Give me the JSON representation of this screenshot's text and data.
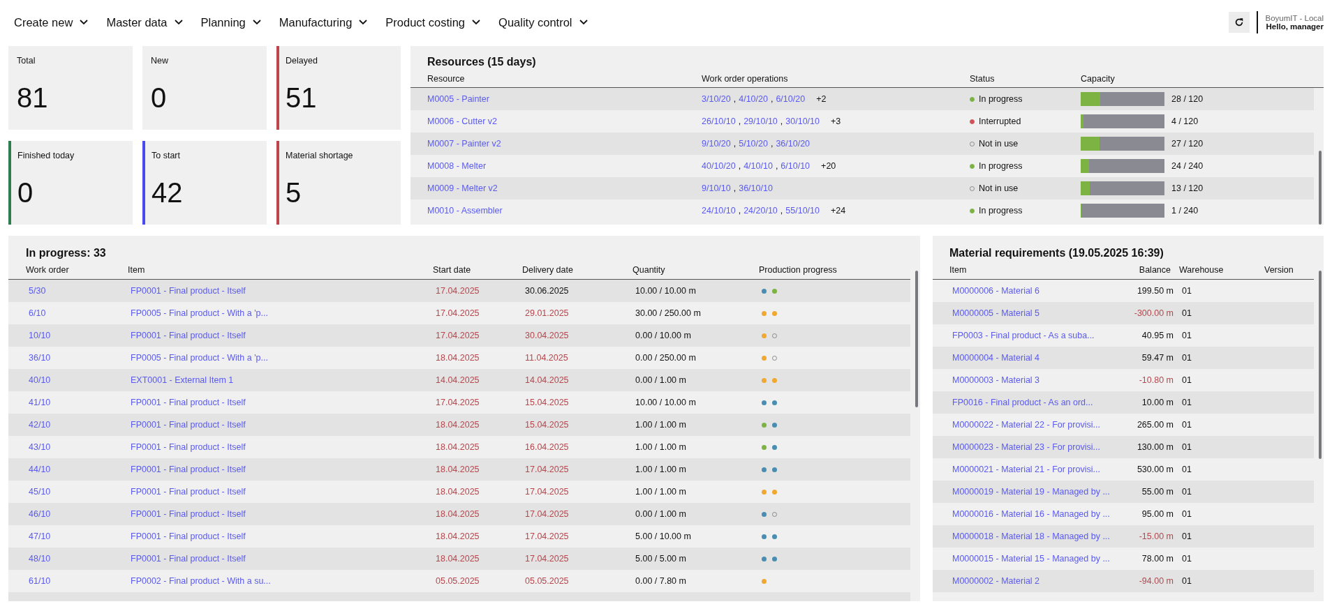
{
  "nav": {
    "menus": [
      {
        "label": "Create new"
      },
      {
        "label": "Master data"
      },
      {
        "label": "Planning"
      },
      {
        "label": "Manufacturing"
      },
      {
        "label": "Product costing"
      },
      {
        "label": "Quality control"
      }
    ],
    "company": "BoyumIT - Local",
    "greeting": "Hello, manager"
  },
  "kpis": [
    {
      "label": "Total",
      "value": "81"
    },
    {
      "label": "New",
      "value": "0"
    },
    {
      "label": "Delayed",
      "value": "51",
      "color": "#c0444c"
    },
    {
      "label": "Finished today",
      "value": "0",
      "color": "#2e7d4f"
    },
    {
      "label": "To start",
      "value": "42",
      "color": "#4a4af0"
    },
    {
      "label": "Material shortage",
      "value": "5",
      "color": "#c0444c"
    }
  ],
  "resources": {
    "title": "Resources (15 days)",
    "separator": ",",
    "columns": [
      "Resource",
      "Work order operations",
      "Status",
      "Capacity"
    ],
    "rows": [
      {
        "resource": "M0005 - Painter",
        "operations": [
          "3/10/20",
          "4/10/20",
          "6/10/20"
        ],
        "more": "+2",
        "status": {
          "kind": "in_progress",
          "label": "In progress"
        },
        "level": 0.233,
        "capacity": "28 / 120"
      },
      {
        "resource": "M0006 - Cutter v2",
        "operations": [
          "26/10/10",
          "29/10/10",
          "30/10/10"
        ],
        "more": "+3",
        "status": {
          "kind": "interrupted",
          "label": "Interrupted"
        },
        "level": 0.033,
        "capacity": "4 / 120"
      },
      {
        "resource": "M0007 - Painter v2",
        "operations": [
          "9/10/20",
          "5/10/20",
          "36/10/20"
        ],
        "status": {
          "kind": "not_in_use",
          "label": "Not in use"
        },
        "level": 0.225,
        "capacity": "27 / 120"
      },
      {
        "resource": "M0008 - Melter",
        "operations": [
          "40/10/20",
          "4/10/10",
          "6/10/10"
        ],
        "more": "+20",
        "status": {
          "kind": "in_progress",
          "label": "In progress"
        },
        "level": 0.1,
        "capacity": "24 / 240"
      },
      {
        "resource": "M0009 - Melter v2",
        "operations": [
          "9/10/10",
          "36/10/10"
        ],
        "status": {
          "kind": "not_in_use",
          "label": "Not in use"
        },
        "level": 0.108,
        "capacity": "13 / 120"
      },
      {
        "resource": "M0010 - Assembler",
        "operations": [
          "24/10/10",
          "24/20/10",
          "55/10/10"
        ],
        "more": "+24",
        "status": {
          "kind": "in_progress",
          "label": "In progress"
        },
        "level": 0.004,
        "capacity": "1 / 240"
      }
    ]
  },
  "in_progress": {
    "title": "In progress: 33",
    "columns": [
      "Work order",
      "Item",
      "Start date",
      "Delivery date",
      "Quantity",
      "Production progress"
    ],
    "rows": [
      {
        "work_order": "5/30",
        "item": "FP0001 - Final product - Itself",
        "start_date": "17.04.2025",
        "start_late": true,
        "delivery_date": "30.06.2025",
        "delivery_late": false,
        "quantity": "10.00 / 10.00 m",
        "progress": [
          {
            "kind": "filled",
            "color": "#4a8db0"
          },
          {
            "kind": "filled",
            "color": "#7cb342"
          }
        ]
      },
      {
        "work_order": "6/10",
        "item": "FP0005 - Final product - With a 'p...",
        "start_date": "17.04.2025",
        "start_late": true,
        "delivery_date": "29.01.2025",
        "delivery_late": true,
        "quantity": "30.00 / 250.00 m",
        "progress": [
          {
            "kind": "filled",
            "color": "#f0a830"
          },
          {
            "kind": "filled",
            "color": "#f0a830"
          }
        ]
      },
      {
        "work_order": "10/10",
        "item": "FP0001 - Final product - Itself",
        "start_date": "17.04.2025",
        "start_late": true,
        "delivery_date": "30.04.2025",
        "delivery_late": true,
        "quantity": "0.00 / 10.00 m",
        "progress": [
          {
            "kind": "filled",
            "color": "#f0a830"
          },
          {
            "kind": "empty"
          }
        ]
      },
      {
        "work_order": "36/10",
        "item": "FP0005 - Final product - With a 'p...",
        "start_date": "18.04.2025",
        "start_late": true,
        "delivery_date": "11.04.2025",
        "delivery_late": true,
        "quantity": "0.00 / 250.00 m",
        "progress": [
          {
            "kind": "filled",
            "color": "#f0a830"
          },
          {
            "kind": "empty"
          }
        ]
      },
      {
        "work_order": "40/10",
        "item": "EXT0001 - External Item 1",
        "start_date": "14.04.2025",
        "start_late": true,
        "delivery_date": "14.04.2025",
        "delivery_late": true,
        "quantity": "0.00 / 1.00 m",
        "progress": [
          {
            "kind": "filled",
            "color": "#f0a830"
          },
          {
            "kind": "filled",
            "color": "#f0a830"
          }
        ]
      },
      {
        "work_order": "41/10",
        "item": "FP0001 - Final product - Itself",
        "start_date": "17.04.2025",
        "start_late": true,
        "delivery_date": "15.04.2025",
        "delivery_late": true,
        "quantity": "10.00 / 10.00 m",
        "progress": [
          {
            "kind": "filled",
            "color": "#4a8db0"
          },
          {
            "kind": "filled",
            "color": "#4a8db0"
          }
        ]
      },
      {
        "work_order": "42/10",
        "item": "FP0001 - Final product - Itself",
        "start_date": "18.04.2025",
        "start_late": true,
        "delivery_date": "15.04.2025",
        "delivery_late": true,
        "quantity": "1.00 / 1.00 m",
        "progress": [
          {
            "kind": "filled",
            "color": "#7cb342"
          },
          {
            "kind": "filled",
            "color": "#4a8db0"
          }
        ]
      },
      {
        "work_order": "43/10",
        "item": "FP0001 - Final product - Itself",
        "start_date": "18.04.2025",
        "start_late": true,
        "delivery_date": "16.04.2025",
        "delivery_late": true,
        "quantity": "1.00 / 1.00 m",
        "progress": [
          {
            "kind": "filled",
            "color": "#7cb342"
          },
          {
            "kind": "filled",
            "color": "#4a8db0"
          }
        ]
      },
      {
        "work_order": "44/10",
        "item": "FP0001 - Final product - Itself",
        "start_date": "18.04.2025",
        "start_late": true,
        "delivery_date": "17.04.2025",
        "delivery_late": true,
        "quantity": "1.00 / 1.00 m",
        "progress": [
          {
            "kind": "filled",
            "color": "#4a8db0"
          },
          {
            "kind": "filled",
            "color": "#4a8db0"
          }
        ]
      },
      {
        "work_order": "45/10",
        "item": "FP0001 - Final product - Itself",
        "start_date": "18.04.2025",
        "start_late": true,
        "delivery_date": "17.04.2025",
        "delivery_late": true,
        "quantity": "1.00 / 1.00 m",
        "progress": [
          {
            "kind": "filled",
            "color": "#f0a830"
          },
          {
            "kind": "filled",
            "color": "#f0a830"
          }
        ]
      },
      {
        "work_order": "46/10",
        "item": "FP0001 - Final product - Itself",
        "start_date": "18.04.2025",
        "start_late": true,
        "delivery_date": "17.04.2025",
        "delivery_late": true,
        "quantity": "0.00 / 1.00 m",
        "progress": [
          {
            "kind": "filled",
            "color": "#4a8db0"
          },
          {
            "kind": "empty"
          }
        ]
      },
      {
        "work_order": "47/10",
        "item": "FP0001 - Final product - Itself",
        "start_date": "18.04.2025",
        "start_late": true,
        "delivery_date": "17.04.2025",
        "delivery_late": true,
        "quantity": "5.00 / 10.00 m",
        "progress": [
          {
            "kind": "filled",
            "color": "#4a8db0"
          },
          {
            "kind": "filled",
            "color": "#4a8db0"
          }
        ]
      },
      {
        "work_order": "48/10",
        "item": "FP0001 - Final product - Itself",
        "start_date": "18.04.2025",
        "start_late": true,
        "delivery_date": "17.04.2025",
        "delivery_late": true,
        "quantity": "5.00 / 5.00 m",
        "progress": [
          {
            "kind": "filled",
            "color": "#4a8db0"
          },
          {
            "kind": "filled",
            "color": "#4a8db0"
          }
        ]
      },
      {
        "work_order": "61/10",
        "item": "FP0002 - Final product - With a su...",
        "start_date": "05.05.2025",
        "start_late": true,
        "delivery_date": "05.05.2025",
        "delivery_late": true,
        "quantity": "0.00 / 7.80 m",
        "progress": [
          {
            "kind": "filled",
            "color": "#f0a830"
          }
        ]
      }
    ]
  },
  "materials": {
    "title": "Material requirements (19.05.2025 16:39)",
    "columns": [
      "Item",
      "Balance",
      "Warehouse",
      "Version"
    ],
    "rows": [
      {
        "item": "M0000006 - Material 6",
        "balance": "199.50 m",
        "negative": false,
        "warehouse": "01"
      },
      {
        "item": "M0000005 - Material 5",
        "balance": "-300.00 m",
        "negative": true,
        "warehouse": "01"
      },
      {
        "item": "FP0003 - Final product - As a suba...",
        "balance": "40.95 m",
        "negative": false,
        "warehouse": "01"
      },
      {
        "item": "M0000004 - Material 4",
        "balance": "59.47 m",
        "negative": false,
        "warehouse": "01"
      },
      {
        "item": "M0000003 - Material 3",
        "balance": "-10.80 m",
        "negative": true,
        "warehouse": "01"
      },
      {
        "item": "FP0016 - Final product - As an ord...",
        "balance": "10.00 m",
        "negative": false,
        "warehouse": "01"
      },
      {
        "item": "M0000022 - Material 22 - For provisi...",
        "balance": "265.00 m",
        "negative": false,
        "warehouse": "01"
      },
      {
        "item": "M0000023 - Material 23 - For provisi...",
        "balance": "130.00 m",
        "negative": false,
        "warehouse": "01"
      },
      {
        "item": "M0000021 - Material 21 - For provisi...",
        "balance": "530.00 m",
        "negative": false,
        "warehouse": "01"
      },
      {
        "item": "M0000019 - Material 19 - Managed by ...",
        "balance": "55.00 m",
        "negative": false,
        "warehouse": "01"
      },
      {
        "item": "M0000016 - Material 16 - Managed by ...",
        "balance": "95.00 m",
        "negative": false,
        "warehouse": "01"
      },
      {
        "item": "M0000018 - Material 18 - Managed by ...",
        "balance": "-15.00 m",
        "negative": true,
        "warehouse": "01"
      },
      {
        "item": "M0000015 - Material 15 - Managed by ...",
        "balance": "78.00 m",
        "negative": false,
        "warehouse": "01"
      },
      {
        "item": "M0000002 - Material 2",
        "balance": "-94.00 m",
        "negative": true,
        "warehouse": "01"
      }
    ]
  }
}
